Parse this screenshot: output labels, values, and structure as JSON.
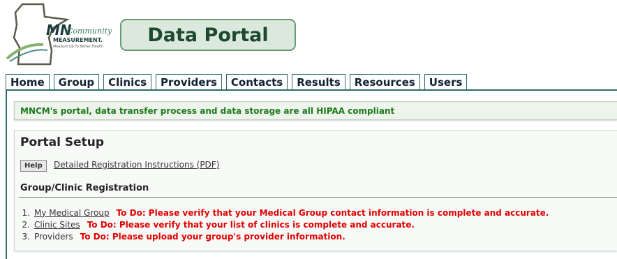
{
  "brand": {
    "logo_text_primary": "MN",
    "logo_text_script": "Community",
    "logo_text_secondary": "MEASUREMENT.",
    "logo_tagline": "Measure Up To Better Health",
    "portal_title": "Data Portal"
  },
  "tabs": [
    {
      "label": "Home"
    },
    {
      "label": "Group"
    },
    {
      "label": "Clinics"
    },
    {
      "label": "Providers"
    },
    {
      "label": "Contacts"
    },
    {
      "label": "Results"
    },
    {
      "label": "Resources"
    },
    {
      "label": "Users"
    }
  ],
  "notice": "MNCM's portal, data transfer process and data storage are all HIPAA compliant",
  "setup": {
    "title": "Portal Setup",
    "help_label": "Help",
    "pdf_link": "Detailed Registration Instructions (PDF)",
    "section_title": "Group/Clinic Registration",
    "items": [
      {
        "num": "1.",
        "label": "My Medical Group",
        "todo": "To Do: Please verify that your Medical Group contact information is complete and accurate."
      },
      {
        "num": "2.",
        "label": "Clinic Sites",
        "todo": "To Do: Please verify that your list of clinics is complete and accurate."
      },
      {
        "num": "3.",
        "label": "Providers",
        "todo": "To Do: Please upload your group's provider information."
      }
    ]
  },
  "colors": {
    "accent": "#2f6b6b",
    "notice_text": "#1b7a1b",
    "todo_text": "#e10000",
    "title_bg": "#dbe8dc"
  }
}
